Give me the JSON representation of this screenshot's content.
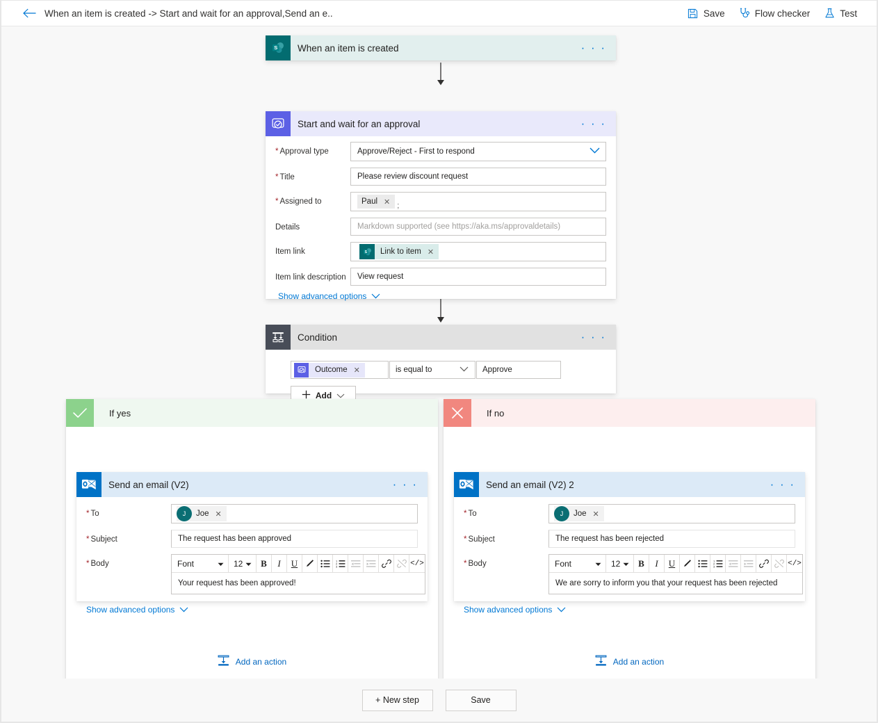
{
  "commandbar": {
    "back_icon": "arrow-left-icon",
    "title": "When an item is created -> Start and wait for an approval,Send an e..",
    "actions": [
      {
        "label": "Save",
        "icon": "save-floppy-icon"
      },
      {
        "label": "Flow checker",
        "icon": "stethoscope-icon"
      },
      {
        "label": "Test",
        "icon": "flask-icon"
      }
    ]
  },
  "trigger": {
    "title": "When an item is created",
    "icon": "sharepoint-icon",
    "header_bg": "#e2efee",
    "icon_bg": "#036c70",
    "more_label": "· · ·"
  },
  "approval": {
    "title": "Start and wait for an approval",
    "icon": "approvals-icon",
    "header_bg": "#e9e9fb",
    "icon_bg": "#5c60e5",
    "more_label": "· · ·",
    "fields": {
      "approval_type": {
        "label": "Approval type",
        "required": true,
        "value": "Approve/Reject - First to respond",
        "control": "dropdown"
      },
      "title": {
        "label": "Title",
        "required": true,
        "value": "Please review discount request",
        "control": "text"
      },
      "assigned_to": {
        "label": "Assigned to",
        "required": true,
        "token": "Paul",
        "separator": ";",
        "control": "people-picker"
      },
      "details": {
        "label": "Details",
        "required": false,
        "placeholder": "Markdown supported (see https://aka.ms/approvaldetails)",
        "value": "",
        "control": "text"
      },
      "item_link": {
        "label": "Item link",
        "required": false,
        "token": "Link to item",
        "token_icon": "sharepoint-icon",
        "control": "token"
      },
      "item_link_description": {
        "label": "Item link description",
        "required": false,
        "value": "View request",
        "control": "text"
      }
    },
    "advanced_link": "Show advanced options"
  },
  "condition": {
    "title": "Condition",
    "icon": "condition-branch-icon",
    "header_bg": "#e1e1e1",
    "icon_bg": "#484d58",
    "more_label": "· · ·",
    "expression": {
      "left_token": "Outcome",
      "left_token_icon": "approvals-icon",
      "operator": "is equal to",
      "right_value": "Approve"
    },
    "add_button": "Add"
  },
  "branches": [
    {
      "id": "yes",
      "label": "If yes",
      "badge_icon": "check-icon",
      "badge_bg": "#8cd28c",
      "header_bg": "#eff8f0",
      "action": {
        "title": "Send an email (V2)",
        "icon": "outlook-icon",
        "header_bg": "#dceaf7",
        "icon_bg": "#0072c6",
        "more_label": "· · ·",
        "fields": {
          "to": {
            "label": "To",
            "required": true,
            "token": "Joe",
            "avatar_initial": "J",
            "avatar_bg": "#0a6e73"
          },
          "subject": {
            "label": "Subject",
            "required": true,
            "value": "The request has been approved"
          },
          "body": {
            "label": "Body",
            "required": true,
            "value": "Your request has been approved!"
          }
        },
        "advanced_link": "Show advanced options"
      },
      "add_action": "Add an action"
    },
    {
      "id": "no",
      "label": "If no",
      "badge_icon": "close-icon",
      "badge_bg": "#f1877f",
      "header_bg": "#fdeeee",
      "action": {
        "title": "Send an email (V2) 2",
        "icon": "outlook-icon",
        "header_bg": "#dceaf7",
        "icon_bg": "#0072c6",
        "more_label": "· · ·",
        "fields": {
          "to": {
            "label": "To",
            "required": true,
            "token": "Joe",
            "avatar_initial": "J",
            "avatar_bg": "#0a6e73"
          },
          "subject": {
            "label": "Subject",
            "required": true,
            "value": "The request has been rejected"
          },
          "body": {
            "label": "Body",
            "required": true,
            "value": "We are sorry to inform you that your request has been rejected"
          }
        },
        "advanced_link": "Show advanced options"
      },
      "add_action": "Add an action"
    }
  ],
  "rte_toolbar": {
    "font_label": "Font",
    "size_label": "12",
    "buttons": [
      {
        "name": "bold-icon",
        "glyph": "B",
        "disabled": false
      },
      {
        "name": "italic-icon",
        "glyph": "I",
        "disabled": false
      },
      {
        "name": "underline-icon",
        "glyph": "U",
        "disabled": false
      },
      {
        "name": "highlight-pen-icon",
        "glyph": "✒",
        "disabled": false
      },
      {
        "name": "bulleted-list-icon",
        "glyph": "☰",
        "disabled": false
      },
      {
        "name": "numbered-list-icon",
        "glyph": "☰",
        "disabled": false
      },
      {
        "name": "decrease-indent-icon",
        "glyph": "☰",
        "disabled": true
      },
      {
        "name": "increase-indent-icon",
        "glyph": "☰",
        "disabled": true
      },
      {
        "name": "insert-link-icon",
        "glyph": "🔗",
        "disabled": false
      },
      {
        "name": "remove-link-icon",
        "glyph": "🔗",
        "disabled": true
      },
      {
        "name": "code-view-icon",
        "glyph": "</>",
        "disabled": false
      }
    ]
  },
  "footer": {
    "new_step": "+ New step",
    "save": "Save"
  }
}
